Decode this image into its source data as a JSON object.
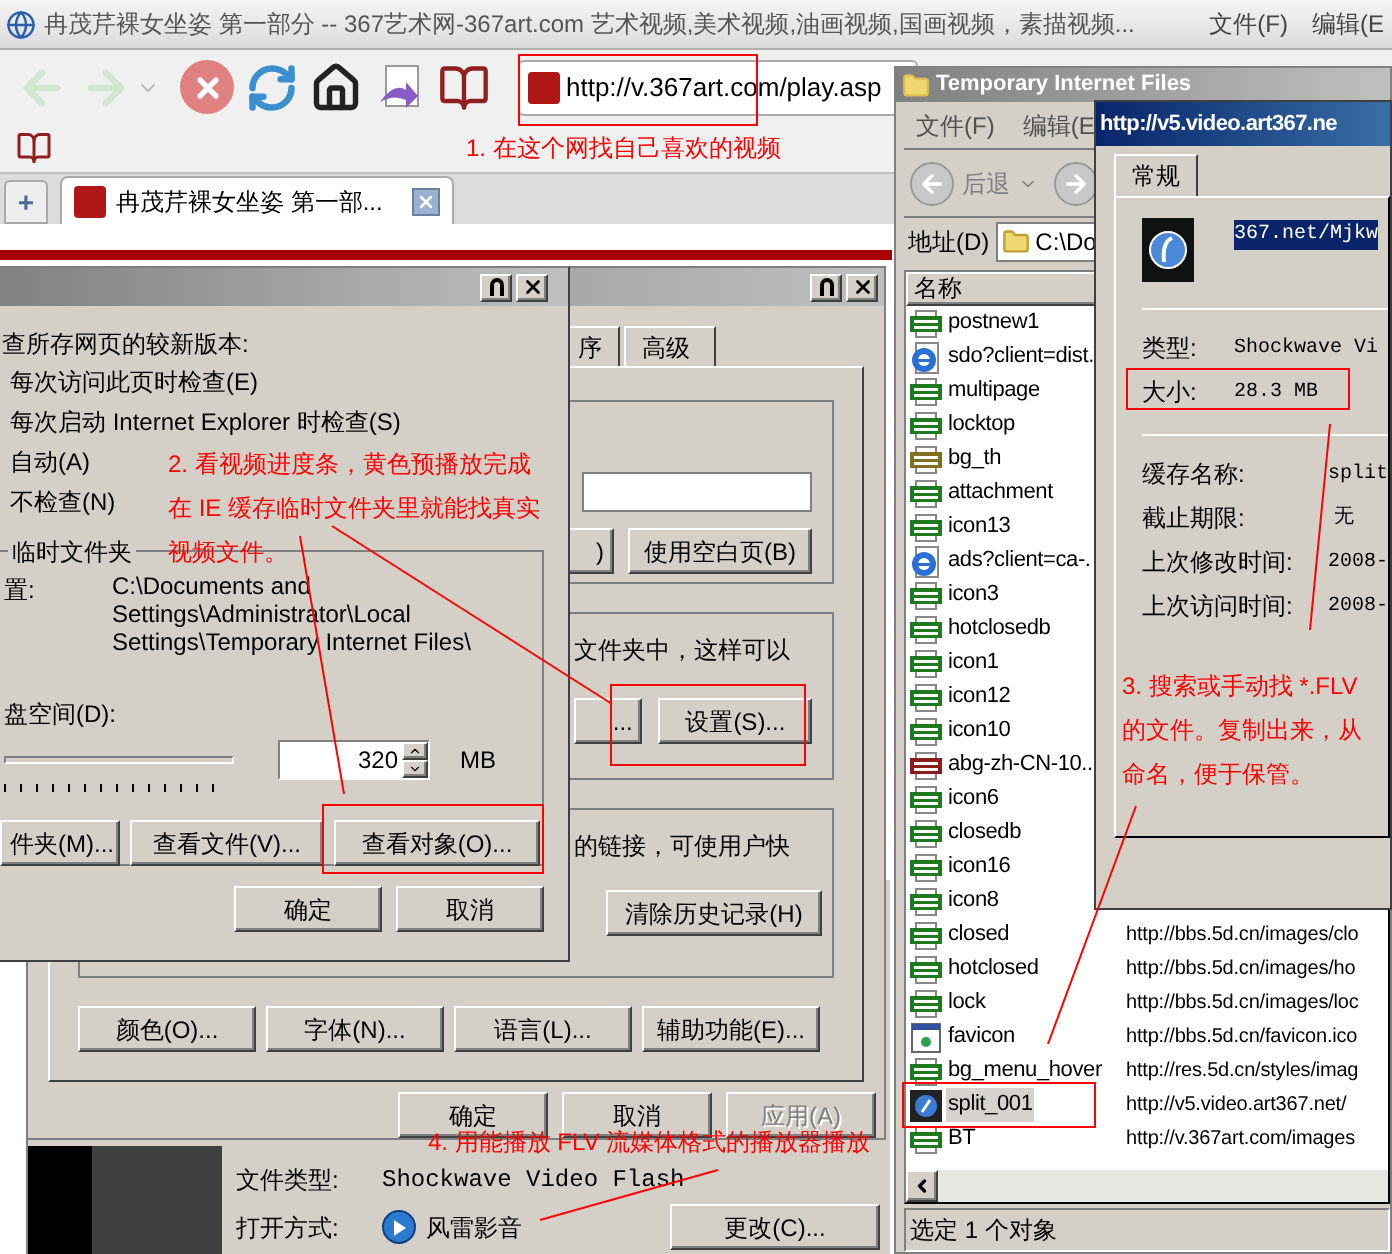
{
  "browser": {
    "title": "冉茂芹裸女坐姿 第一部分 -- 367艺术网-367art.com 艺术视频,美术视频,油画视频,国画视频，素描视频...",
    "menu": [
      "文件(F)",
      "编辑(E"
    ],
    "address": "http://v.367art.com/play.asp",
    "new_tab": "+",
    "tab": {
      "label": "冉茂芹裸女坐姿 第一部...",
      "selected": true
    }
  },
  "internet_options": {
    "tabs": [
      {
        "label": "序",
        "selected": false
      },
      {
        "label": "高级",
        "selected": false
      }
    ],
    "home_buttons": [
      ")",
      "使用空白页(B)"
    ],
    "temp_text": "文件夹中，这样可以",
    "temp_buttons": [
      "...",
      "设置(S)..."
    ],
    "history_text": "的链接，可使用户快",
    "clear_history_button": "清除历史记录(H)",
    "bottom_buttons": [
      "颜色(O)...",
      "字体(N)...",
      "语言(L)...",
      "辅助功能(E)..."
    ],
    "footer_buttons": [
      {
        "label": "确定",
        "disabled": false
      },
      {
        "label": "取消",
        "disabled": false
      },
      {
        "label": "应用(A)",
        "disabled": true
      }
    ]
  },
  "cache_settings": {
    "heading": "查所存网页的较新版本:",
    "options": [
      "每次访问此页时检查(E)",
      "每次启动 Internet Explorer 时检查(S)",
      "自动(A)",
      "不检查(N)"
    ],
    "folder_group": "临时文件夹",
    "location_label": "置:",
    "location": "C:\\Documents and Settings\\Administrator\\Local Settings\\Temporary Internet Files\\",
    "disk_label": "盘空间(D):",
    "disk_value": "320",
    "disk_unit": "MB",
    "buttons": [
      "件夹(M)...",
      "查看文件(V)...",
      "查看对象(O)..."
    ],
    "footer_buttons": [
      "确定",
      "取消"
    ]
  },
  "file_properties": {
    "type_label": "文件类型:",
    "type_value": "Shockwave Video Flash",
    "open_label": "打开方式:",
    "open_value": "风雷影音",
    "change_button": "更改(C)..."
  },
  "explorer": {
    "title": "Temporary Internet Files",
    "menu": [
      "文件(F)",
      "编辑(E"
    ],
    "back": "后退",
    "address_label": "地址(D)",
    "address": "C:\\Do",
    "column": "名称",
    "files": [
      {
        "name": "postnew1",
        "kind": "gif",
        "selected": false
      },
      {
        "name": "sdo?client=dist.",
        "kind": "web",
        "selected": false
      },
      {
        "name": "multipage",
        "kind": "gif",
        "selected": false
      },
      {
        "name": "locktop",
        "kind": "gif",
        "selected": false
      },
      {
        "name": "bg_th",
        "kind": "jpg",
        "selected": false
      },
      {
        "name": "attachment",
        "kind": "gif",
        "selected": false
      },
      {
        "name": "icon13",
        "kind": "gif",
        "selected": false
      },
      {
        "name": "ads?client=ca-.",
        "kind": "web",
        "selected": false
      },
      {
        "name": "icon3",
        "kind": "gif",
        "selected": false
      },
      {
        "name": "hotclosedb",
        "kind": "gif",
        "selected": false
      },
      {
        "name": "icon1",
        "kind": "gif",
        "selected": false
      },
      {
        "name": "icon12",
        "kind": "gif",
        "selected": false
      },
      {
        "name": "icon10",
        "kind": "gif",
        "selected": false
      },
      {
        "name": "abg-zh-CN-10..",
        "kind": "png",
        "selected": false
      },
      {
        "name": "icon6",
        "kind": "gif",
        "selected": false
      },
      {
        "name": "closedb",
        "kind": "gif",
        "selected": false
      },
      {
        "name": "icon16",
        "kind": "gif",
        "selected": false
      },
      {
        "name": "icon8",
        "kind": "gif",
        "selected": false
      },
      {
        "name": "closed",
        "kind": "gif",
        "url": "http://bbs.5d.cn/images/clo",
        "selected": false
      },
      {
        "name": "hotclosed",
        "kind": "gif",
        "url": "http://bbs.5d.cn/images/ho",
        "selected": false
      },
      {
        "name": "lock",
        "kind": "gif",
        "url": "http://bbs.5d.cn/images/loc",
        "selected": false
      },
      {
        "name": "favicon",
        "kind": "ico",
        "url": "http://bbs.5d.cn/favicon.ico",
        "selected": false
      },
      {
        "name": "bg_menu_hover",
        "kind": "gif",
        "url": "http://res.5d.cn/styles/imag",
        "selected": false
      },
      {
        "name": "split_001",
        "kind": "flv",
        "url": "http://v5.video.art367.net/",
        "selected": true
      },
      {
        "name": "BT",
        "kind": "gif",
        "url": "http://v.367art.com/images",
        "selected": false
      }
    ],
    "status": "选定 1 个对象"
  },
  "properties": {
    "title": "http://v5.video.art367.ne",
    "tab": {
      "label": "常规",
      "selected": true
    },
    "url": "367.net/Mjkw",
    "general": [
      {
        "label": "类型:",
        "value": "Shockwave Vi"
      },
      {
        "label": "大小:",
        "value": "28.3 MB"
      }
    ],
    "cache": [
      {
        "label": "缓存名称:",
        "value": "split"
      },
      {
        "label": "截止期限:",
        "value": "无"
      },
      {
        "label": "上次修改时间:",
        "value": "2008-"
      },
      {
        "label": "上次访问时间:",
        "value": "2008-"
      }
    ]
  },
  "annotations": [
    {
      "lines": [
        "1. 在这个网找自己喜欢的视频"
      ]
    },
    {
      "lines": [
        "2. 看视频进度条，黄色预播放完成",
        "在 IE 缓存临时文件夹里就能找真实",
        "视频文件。"
      ]
    },
    {
      "lines": [
        "3. 搜索或手动找 *.FLV",
        "的文件。复制出来，从",
        "命名，便于保管。"
      ]
    },
    {
      "lines": [
        "4. 用能播放 FLV 流媒体格式的播放器播放"
      ]
    }
  ]
}
